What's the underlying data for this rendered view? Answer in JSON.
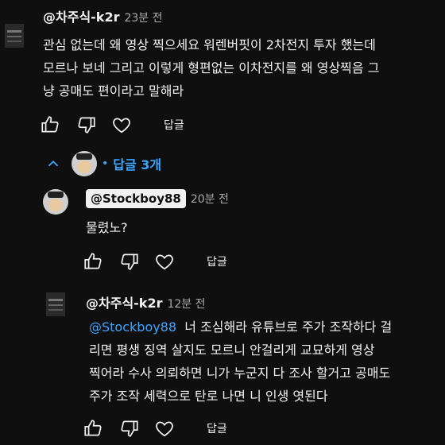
{
  "comment": {
    "author": "@차주식-k2r",
    "time": "23분 전",
    "lines": [
      "관심 없는데 왜 영상 찍으세요 워렌버핏이 2차전지 투자 했는데",
      "모르나 보네  그리고  이렇게 형편없는 이차전지를 왜 영상찍음 그",
      "냥  공매도 편이라고 말해라"
    ],
    "reply_label": "답글"
  },
  "replies_toggle": {
    "label": "답글 3개",
    "icon": "chevron-up-icon"
  },
  "reply1": {
    "author": "@Stockboy88",
    "time": "20분 전",
    "text": "물렸노?",
    "reply_label": "답글"
  },
  "reply2": {
    "author": "@차주식-k2r",
    "time": "12분 전",
    "mention": "@Stockboy88",
    "line1_rest": "너 조심해라 유튜브로 주가 조작하다 걸",
    "lines": [
      "리면 평생  징역 살지도 모르니 안걸리게 교묘하게  영상",
      "찍어라 수사 의뢰하면 니가 누군지 다 조사 할거고 공매도",
      "주가 조작 세력으로 탄로 나면 니 인생 엿된다"
    ],
    "reply_label": "답글"
  },
  "colors": {
    "background": "#0f0f0f",
    "text": "#f1f1f1",
    "secondary": "#aaaaaa",
    "link": "#3ea6ff"
  }
}
